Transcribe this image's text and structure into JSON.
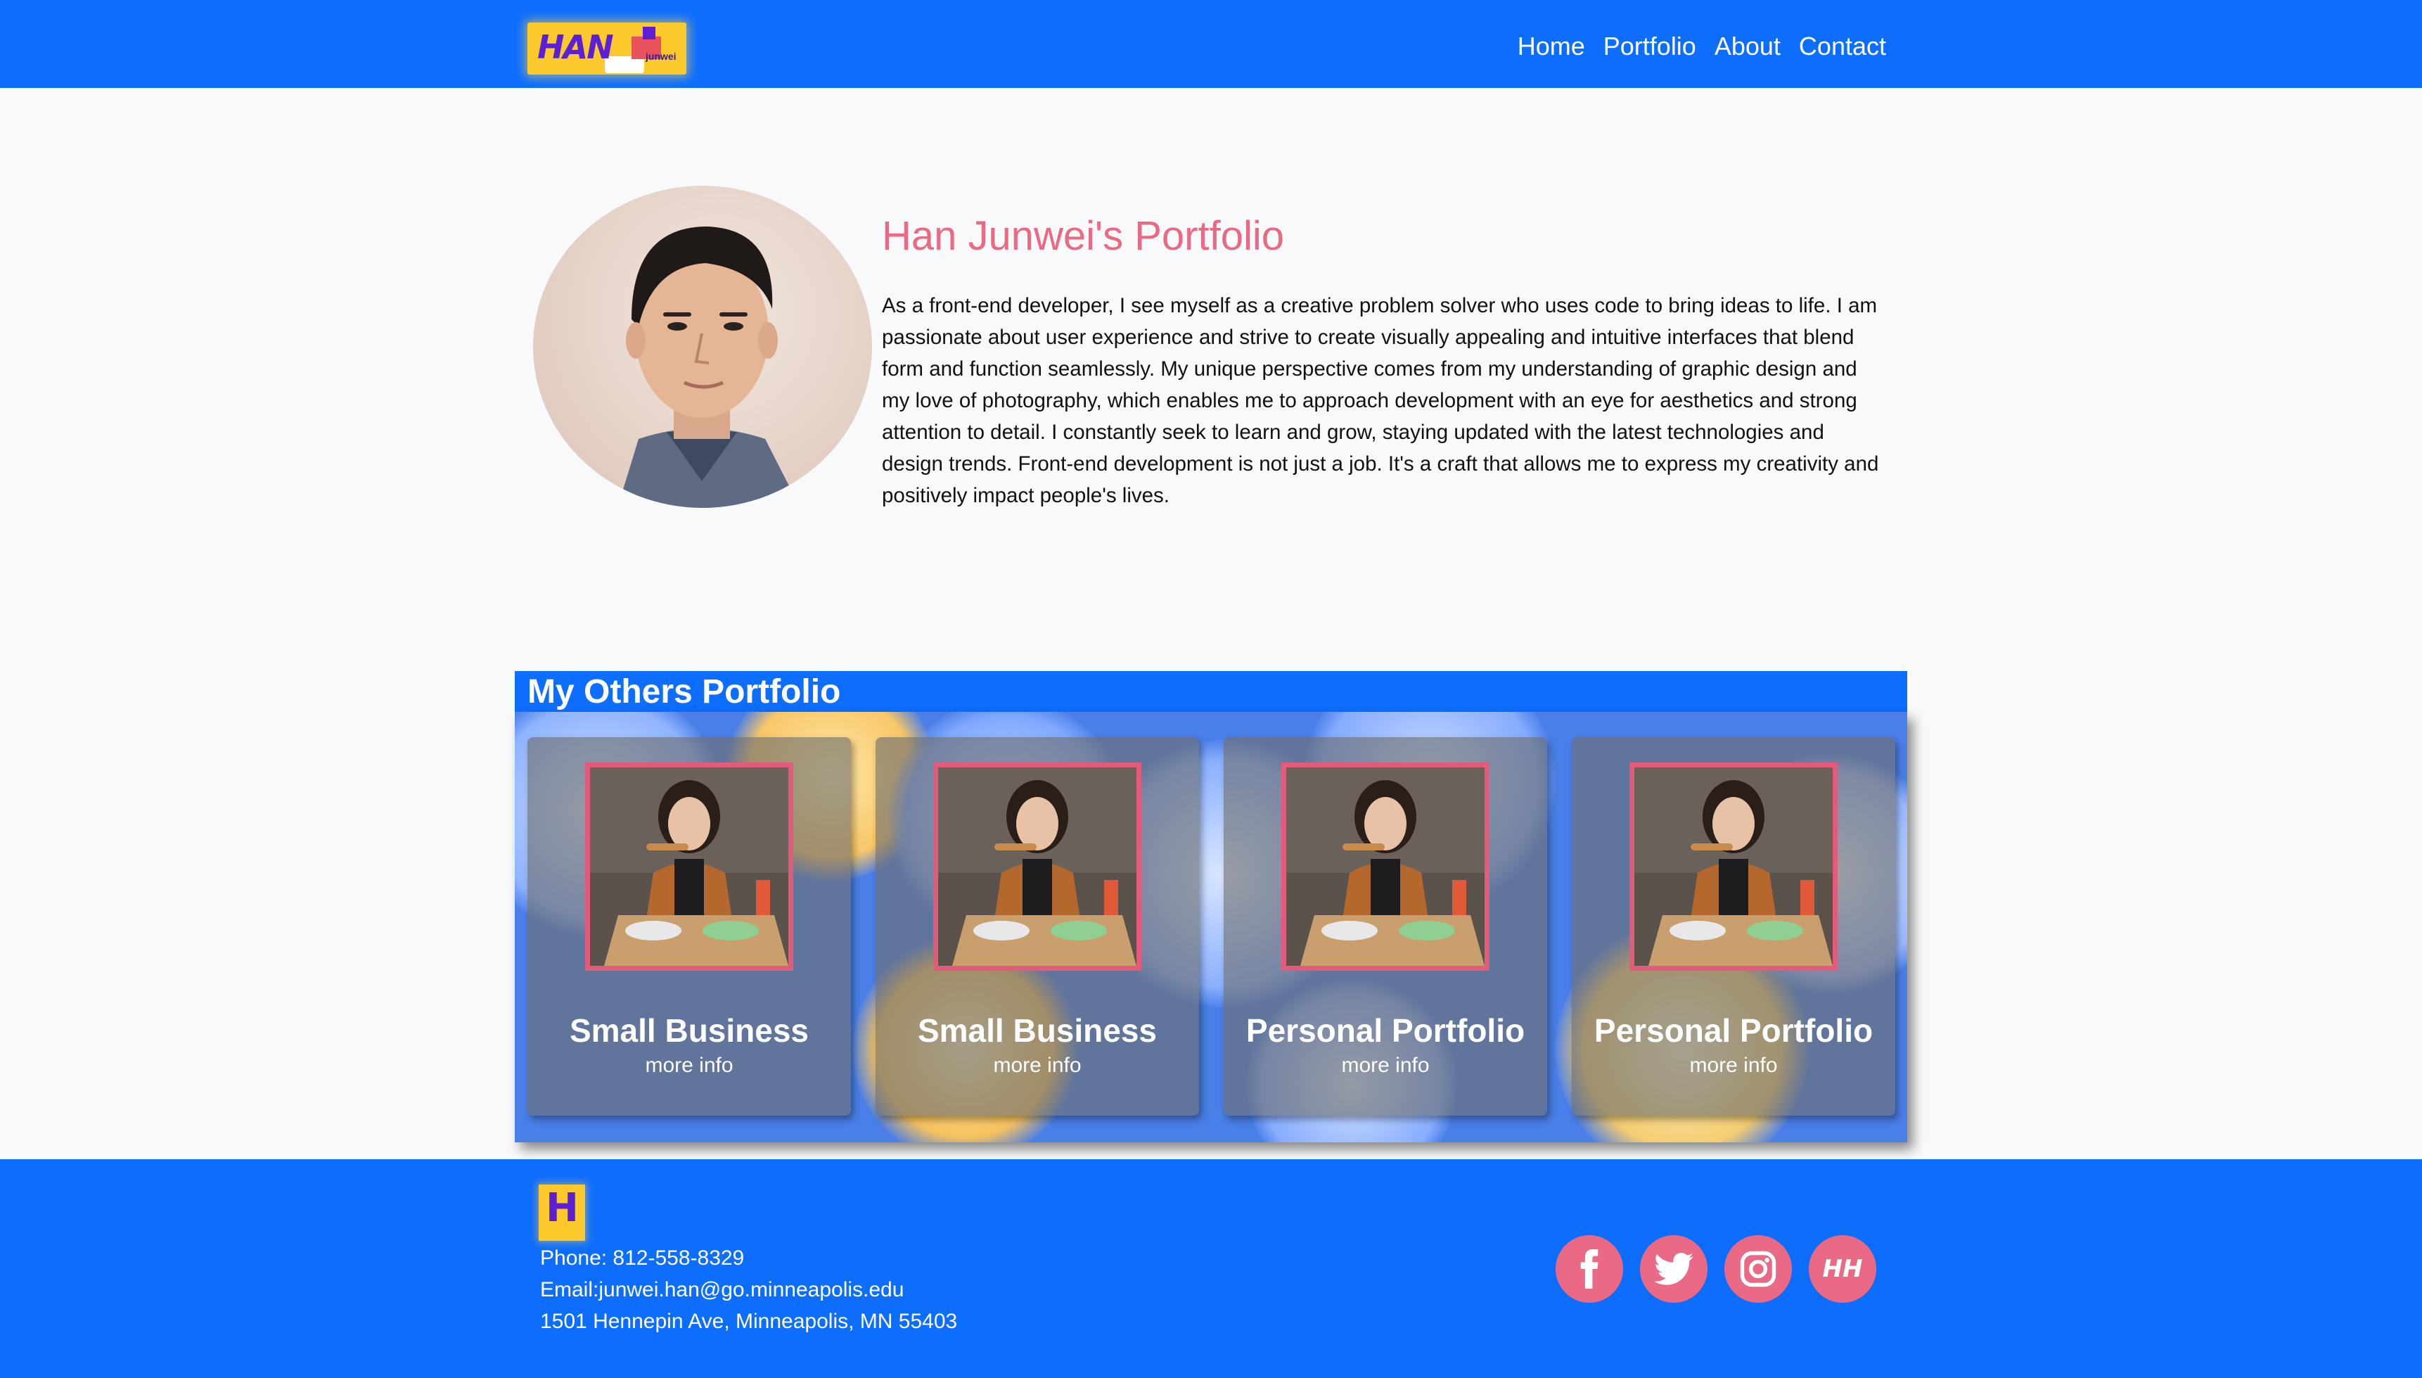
{
  "brand": {
    "logo_text": "HAN",
    "logo_sub": "junwei"
  },
  "nav": {
    "items": [
      {
        "label": "Home"
      },
      {
        "label": "Portfolio"
      },
      {
        "label": "About"
      },
      {
        "label": "Contact"
      }
    ]
  },
  "hero": {
    "title": "Han Junwei's Portfolio",
    "bio": "As a front-end developer, I see myself as a creative problem solver who uses code to bring ideas to life. I am passionate about user experience and strive to create visually appealing and intuitive interfaces that blend form and function seamlessly. My unique perspective comes from my understanding of graphic design and my love of photography, which enables me to approach development with an eye for aesthetics and strong attention to detail. I constantly seek to learn and grow, staying updated with the latest technologies and design trends. Front-end development is not just a job. It's a craft that allows me to express my creativity and positively impact people's lives."
  },
  "portfolio": {
    "title": "My Others Portfolio",
    "cards": [
      {
        "title": "Small Business",
        "link": "more info"
      },
      {
        "title": "Small Business",
        "link": "more info"
      },
      {
        "title": "Personal Portfolio",
        "link": "more info"
      },
      {
        "title": "Personal Portfolio",
        "link": "more info"
      }
    ]
  },
  "footer": {
    "logo_letter": "H",
    "phone": "Phone: 812-558-8329",
    "email": "Email:junwei.han@go.minneapolis.edu",
    "address": "1501 Hennepin Ave, Minneapolis, MN 55403",
    "social": [
      {
        "icon": "facebook-icon"
      },
      {
        "icon": "twitter-icon"
      },
      {
        "icon": "instagram-icon"
      },
      {
        "icon": "hh-icon",
        "label": "HH"
      }
    ]
  },
  "colors": {
    "primary": "#0d6efd",
    "accent": "#ea6a86",
    "logo_bg": "#fcc92c",
    "photo_border": "#e35b7b"
  }
}
